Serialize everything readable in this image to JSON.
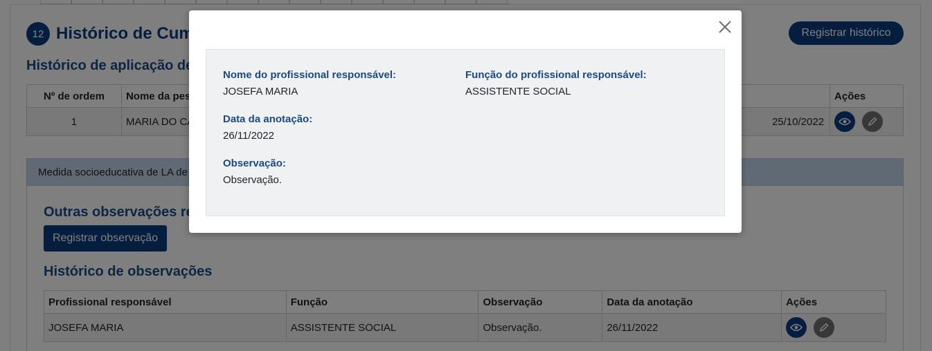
{
  "background": {
    "section_number": "12",
    "section_title": "Histórico de Cumprimento",
    "register_history_button": "Registrar histórico",
    "subtitle": "Histórico de aplicação de",
    "top_table": {
      "headers": [
        "Nº de ordem",
        "Nome da pessoa",
        "Ações"
      ],
      "row": {
        "ordem": "1",
        "nome": "MARIA DO CARMO",
        "data_partial": "25/10/2022"
      }
    },
    "collapse_label": "Medida socioeducativa de LA de",
    "outras_title": "Outras observações referentes",
    "register_observation_button": "Registrar observação",
    "history_title": "Histórico de observações",
    "obs_table": {
      "headers": [
        "Profissional responsável",
        "Função",
        "Observação",
        "Data da anotação",
        "Ações"
      ],
      "rows": [
        {
          "profissional": "JOSEFA MARIA",
          "funcao": "ASSISTENTE SOCIAL",
          "observacao": "Observação.",
          "data": "26/11/2022"
        }
      ]
    }
  },
  "modal": {
    "close_icon": "close-icon",
    "fields": {
      "nome_label": "Nome do profissional responsável:",
      "nome_value": "JOSEFA MARIA",
      "funcao_label": "Função do profissional responsável:",
      "funcao_value": "ASSISTENTE SOCIAL",
      "data_label": "Data da anotação:",
      "data_value": "26/11/2022",
      "obs_label": "Observação:",
      "obs_value": "Observação."
    }
  },
  "colors": {
    "primary": "#0b3d7e",
    "heading": "#1a4a87",
    "edit_button": "#707070",
    "collapse_header_bg": "#c3d4e8"
  }
}
